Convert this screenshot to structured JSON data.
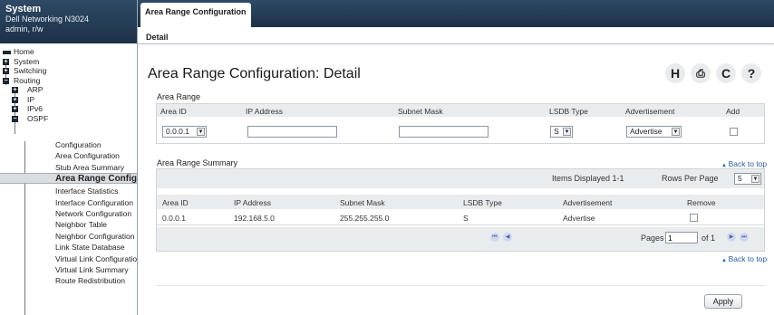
{
  "sidebar": {
    "title": "System",
    "device": "Dell Networking N3024",
    "user": "admin, r/w",
    "tree": {
      "home": "Home",
      "system": "System",
      "switching": "Switching",
      "routing": "Routing",
      "arp": "ARP",
      "ip": "IP",
      "ipv6": "IPv6",
      "ospf": "OSPF",
      "ospf_items": [
        "Configuration",
        "Area Configuration",
        "Stub Area Summary",
        "Area Range Configuration",
        "Interface Statistics",
        "Interface Configuration",
        "Network Configuration",
        "Neighbor Table",
        "Neighbor Configuration",
        "Link State Database",
        "Virtual Link Configuration",
        "Virtual Link Summary",
        "Route Redistribution"
      ]
    }
  },
  "tabs": {
    "main": "Area Range Configuration",
    "sub": "Detail"
  },
  "page": {
    "title": "Area Range Configuration: Detail"
  },
  "toolbar": {
    "help": "H",
    "print": "⎙",
    "refresh": "C",
    "question": "?"
  },
  "area_range": {
    "label": "Area Range",
    "headers": {
      "area_id": "Area ID",
      "ip": "IP Address",
      "mask": "Subnet Mask",
      "lsdb": "LSDB Type",
      "adv": "Advertisement",
      "add": "Add"
    },
    "area_id_value": "0.0.0.1",
    "ip_value": "",
    "mask_value": "",
    "lsdb_value": "S",
    "adv_value": "Advertise",
    "add_checked": false
  },
  "summary": {
    "label": "Area Range Summary",
    "back_to_top": "Back to top",
    "items_displayed": "Items Displayed 1-1",
    "rows_per_page_label": "Rows Per Page",
    "rows_per_page": "5",
    "headers": {
      "area_id": "Area ID",
      "ip": "IP Address",
      "mask": "Subnet Mask",
      "lsdb": "LSDB Type",
      "adv": "Advertisement",
      "remove": "Remove"
    },
    "rows": [
      {
        "area_id": "0.0.0.1",
        "ip": "192.168.5.0",
        "mask": "255.255.255.0",
        "lsdb": "S",
        "adv": "Advertise"
      }
    ],
    "pages_label": "Pages",
    "page_value": "1",
    "of_label": "of 1",
    "back_to_top_2": "Back to top"
  },
  "apply_label": "Apply",
  "colors": {
    "header_bg": "#1d3147",
    "link": "#2a5ca8"
  }
}
